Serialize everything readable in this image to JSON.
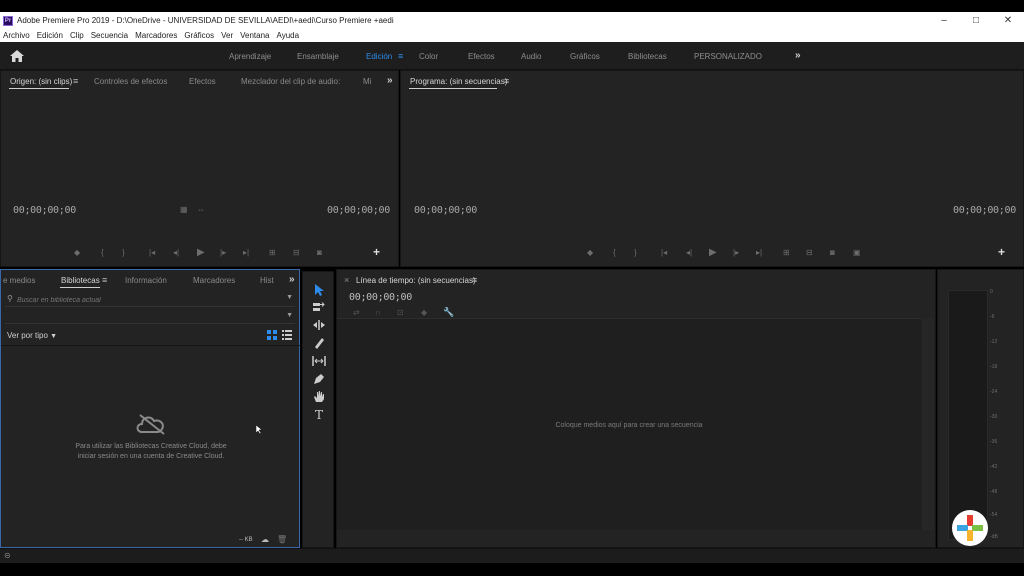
{
  "window": {
    "title": "Adobe Premiere Pro 2019 - D:\\OneDrive - UNIVERSIDAD DE SEVILLA\\AEDI\\+aedi\\Curso Premiere +aedi",
    "controls": [
      "minimize-icon",
      "maximize-icon",
      "close-icon"
    ]
  },
  "menu": [
    "Archivo",
    "Edición",
    "Clip",
    "Secuencia",
    "Marcadores",
    "Gráficos",
    "Ver",
    "Ventana",
    "Ayuda"
  ],
  "workspaces": {
    "tabs": [
      "Aprendizaje",
      "Ensamblaje",
      "Edición",
      "Color",
      "Efectos",
      "Audio",
      "Gráficos",
      "Bibliotecas",
      "PERSONALIZADO"
    ],
    "active": "Edición",
    "more": "»"
  },
  "source_panel": {
    "tabs": [
      "Origen: (sin clips)",
      "Controles de efectos",
      "Efectos",
      "Mezclador del clip de audio:",
      "Mi"
    ],
    "menu_glyph": "≡",
    "overflow": "»",
    "timecode_left": "00;00;00;00",
    "timecode_right": "00;00;00;00"
  },
  "program_panel": {
    "title": "Programa: (sin secuencias)",
    "menu_glyph": "≡",
    "timecode_left": "00;00;00;00",
    "timecode_right": "00;00;00;00"
  },
  "library_panel": {
    "tabs": [
      "e medios",
      "Bibliotecas",
      "Información",
      "Marcadores",
      "Hist"
    ],
    "menu_glyph": "≡",
    "overflow": "»",
    "search_placeholder": "Buscar en biblioteca actual",
    "view_by": "Ver por tipo",
    "empty_message": "Para utilizar las Bibliotecas Creative Cloud, debe iniciar sesión en una cuenta de Creative Cloud.",
    "footer_kb": "-- KB"
  },
  "timeline_panel": {
    "close_glyph": "×",
    "title": "Línea de tiempo: (sin secuencias)",
    "menu_glyph": "≡",
    "timecode": "00;00;00;00",
    "empty_message": "Coloque medios aquí para crear una secuencia"
  },
  "audio_meter": {
    "scale": [
      "0",
      "-6",
      "-12",
      "-18",
      "-24",
      "-30",
      "-36",
      "-42",
      "-48",
      "-54",
      "-dB"
    ]
  },
  "colors": {
    "accent_blue": "#2d8ceb",
    "panel_bg": "#232323",
    "workspace_bg": "#1e1e1e",
    "title_bg": "#ffffff"
  }
}
